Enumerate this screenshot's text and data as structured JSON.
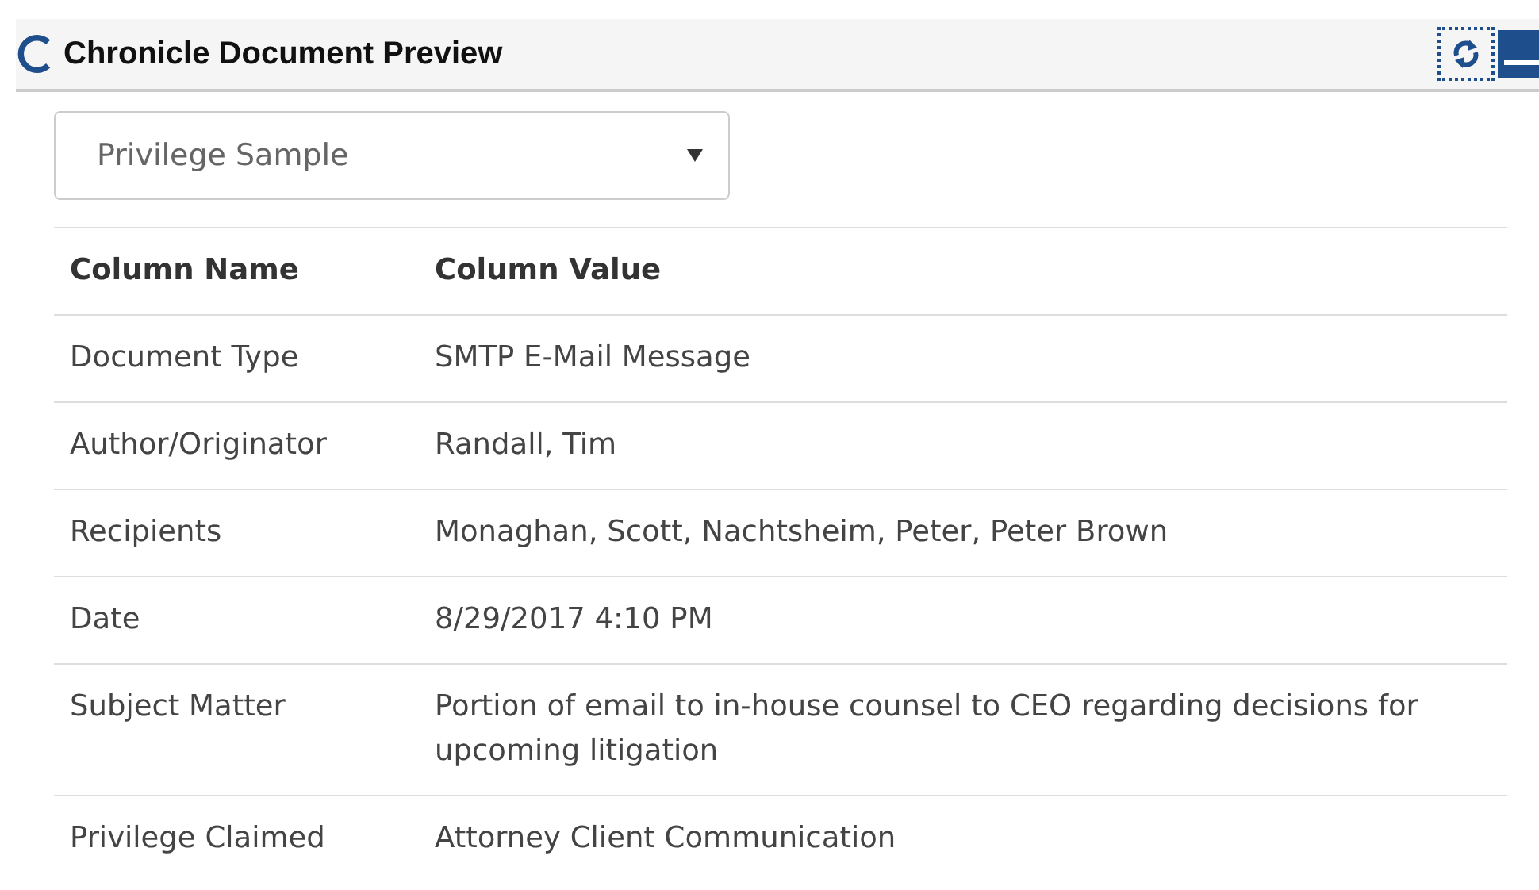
{
  "window": {
    "title": "Chronicle Document Preview"
  },
  "selector": {
    "value": "Privilege Sample"
  },
  "table": {
    "columns": [
      "Column Name",
      "Column Value"
    ],
    "rows": [
      {
        "name": "Document Type",
        "value": "SMTP E-Mail Message"
      },
      {
        "name": "Author/Originator",
        "value": "Randall, Tim"
      },
      {
        "name": "Recipients",
        "value": "Monaghan, Scott, Nachtsheim, Peter, Peter Brown"
      },
      {
        "name": "Date",
        "value": "8/29/2017 4:10 PM"
      },
      {
        "name": "Subject Matter",
        "value": "Portion of email to in-house counsel to CEO regarding decisions for upcoming litigation"
      },
      {
        "name": "Privilege Claimed",
        "value": "Attorney Client Communication"
      }
    ]
  }
}
